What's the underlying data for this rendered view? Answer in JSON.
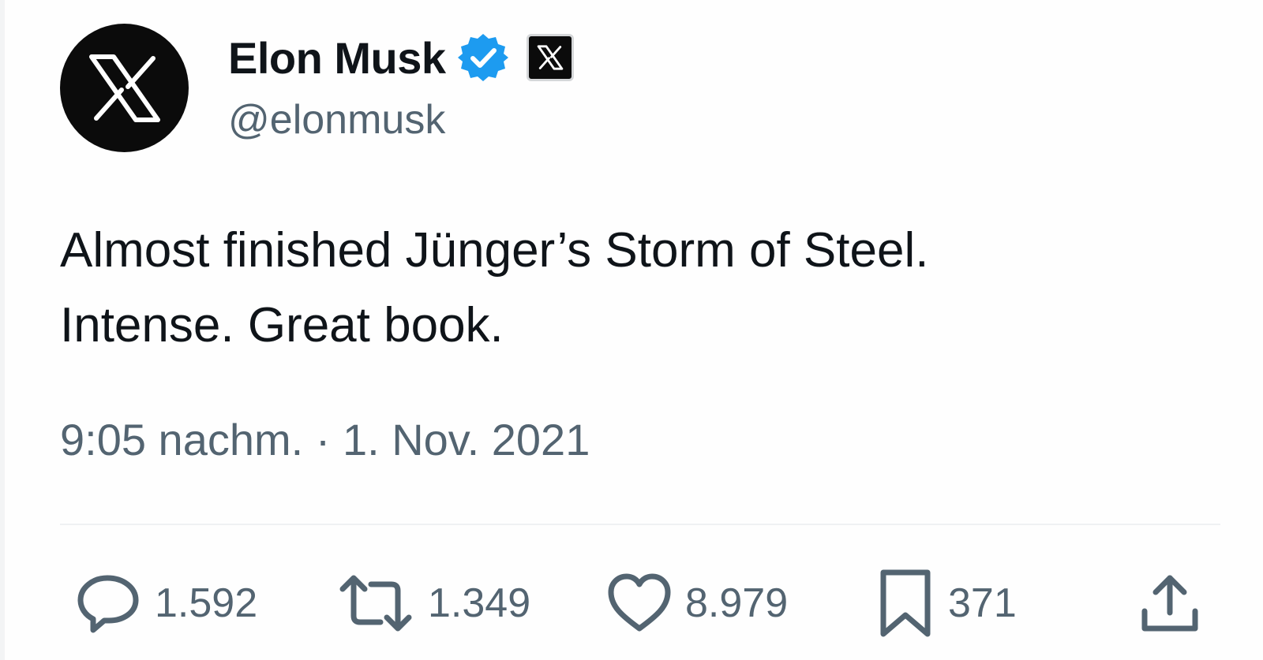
{
  "user": {
    "display_name": "Elon Musk",
    "handle": "@elonmusk",
    "avatar_icon": "x-logo-icon",
    "verified_icon": "verified-badge-icon",
    "affiliation_icon": "x-logo-icon"
  },
  "tweet": {
    "text_lines": [
      "Almost finished Jünger’s Storm of Steel.",
      "Intense. Great book."
    ],
    "timestamp": "9:05 nachm. · 1. Nov. 2021"
  },
  "actions": {
    "replies": "1.592",
    "retweets": "1.349",
    "likes": "8.979",
    "bookmarks": "371",
    "icons": [
      "reply-icon",
      "retweet-icon",
      "like-icon",
      "bookmark-icon",
      "share-icon"
    ]
  },
  "colors": {
    "text_primary": "#0f1419",
    "text_secondary": "#536471",
    "verified_blue": "#1d9bf0",
    "avatar_bg": "#0b0b0b"
  }
}
